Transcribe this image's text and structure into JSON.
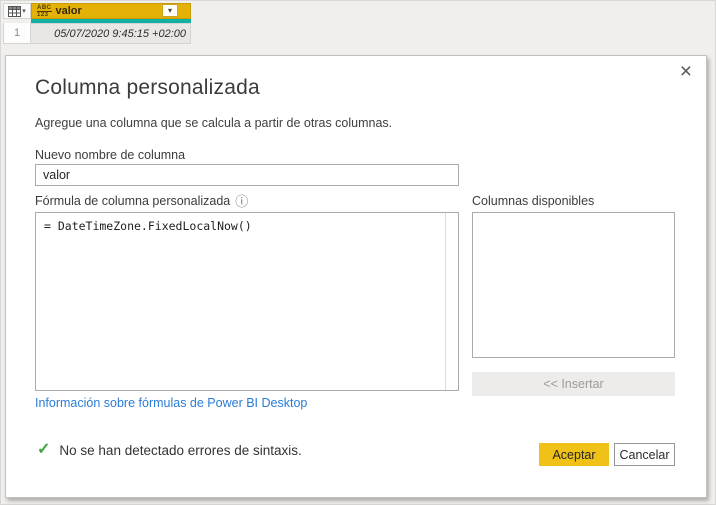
{
  "preview_table": {
    "column_type_icon": {
      "top": "ABC",
      "bottom": "123"
    },
    "column_name": "valor",
    "rows": [
      {
        "num": "1",
        "value": "05/07/2020 9:45:15 +02:00"
      }
    ]
  },
  "dialog": {
    "title": "Columna personalizada",
    "subtitle": "Agregue una columna que se calcula a partir de otras columnas.",
    "new_column_name_label": "Nuevo nombre de columna",
    "new_column_name_value": "valor",
    "formula_label": "Fórmula de columna personalizada",
    "formula_value": "= DateTimeZone.FixedLocalNow()",
    "available_columns_label": "Columnas disponibles",
    "insert_button_label": "<< Insertar",
    "help_link": "Información sobre fórmulas de Power BI Desktop",
    "syntax_status": "No se han detectado errores de sintaxis.",
    "accept_button_label": "Aceptar",
    "cancel_button_label": "Cancelar"
  },
  "icons": {
    "close": "×",
    "info": "ⓘ",
    "check": "✓",
    "dropdown": "▾"
  },
  "colors": {
    "column_header_gold": "#e4b107",
    "quality_bar_teal": "#12b0a4",
    "accept_button_gold": "#f0c117",
    "link_blue": "#2b7cd6",
    "check_green": "#3da53f"
  }
}
